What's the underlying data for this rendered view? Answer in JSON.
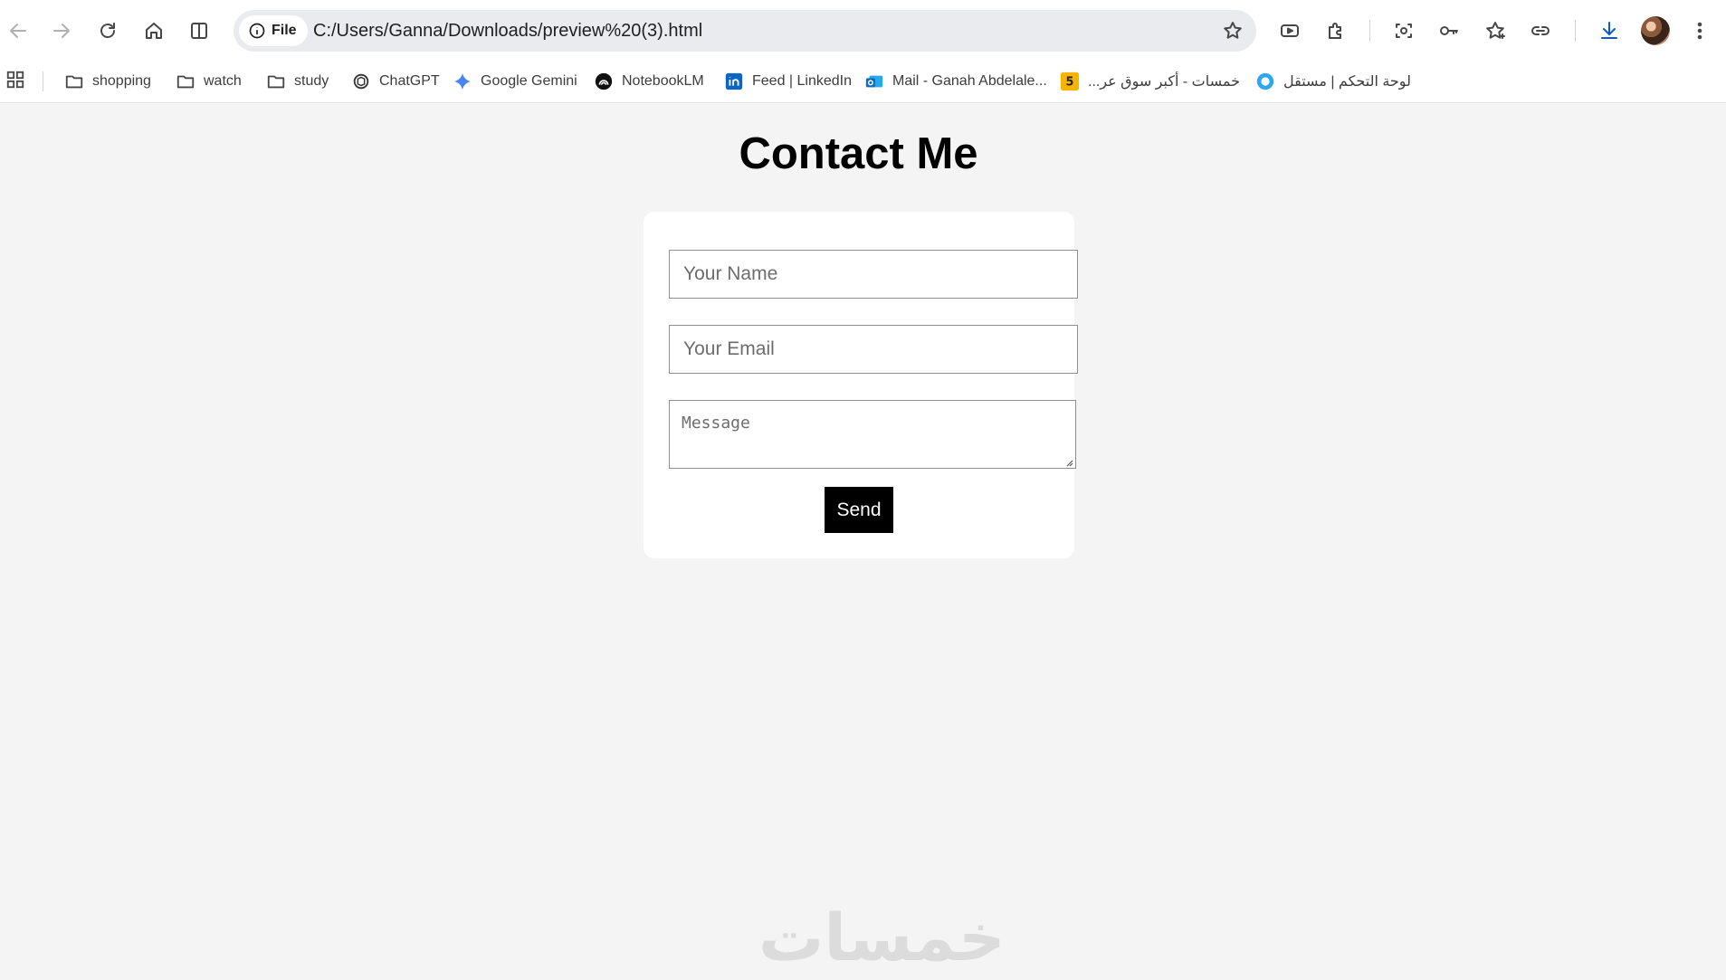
{
  "browser": {
    "address_chip": "File",
    "url": "C:/Users/Ganna/Downloads/preview%20(3).html",
    "icons": [
      "back-icon",
      "forward-icon",
      "reload-icon",
      "home-icon",
      "split-view-icon",
      "info-icon",
      "bookmark-star-icon",
      "media-icon",
      "extensions-icon",
      "screenshot-icon",
      "password-key-icon",
      "favorites-icon",
      "link-icon",
      "download-icon",
      "menu-icon"
    ]
  },
  "bookmarks": [
    {
      "label": "shopping",
      "icon": "folder-icon"
    },
    {
      "label": "watch",
      "icon": "folder-icon"
    },
    {
      "label": "study",
      "icon": "folder-icon"
    },
    {
      "label": "ChatGPT",
      "icon": "chatgpt-icon"
    },
    {
      "label": "Google Gemini",
      "icon": "gemini-icon"
    },
    {
      "label": "NotebookLM",
      "icon": "notebooklm-icon"
    },
    {
      "label": "Feed | LinkedIn",
      "icon": "linkedin-icon"
    },
    {
      "label": "Mail - Ganah Abdelale...",
      "icon": "outlook-icon"
    },
    {
      "label": "خمسات - أكبر سوق عر...",
      "icon": "khamsat-icon",
      "badge": "5"
    },
    {
      "label": "لوحة التحكم | مستقل",
      "icon": "mostaql-icon"
    }
  ],
  "page": {
    "title": "Contact Me",
    "name_placeholder": "Your Name",
    "email_placeholder": "Your Email",
    "message_placeholder": "Message",
    "send_label": "Send",
    "watermark": "خمسات"
  },
  "colors": {
    "page_bg": "#f4f4f4",
    "card_bg": "#ffffff",
    "button_bg": "#000000",
    "linkedin": "#0a66c2",
    "download_accent": "#0b57d0"
  }
}
